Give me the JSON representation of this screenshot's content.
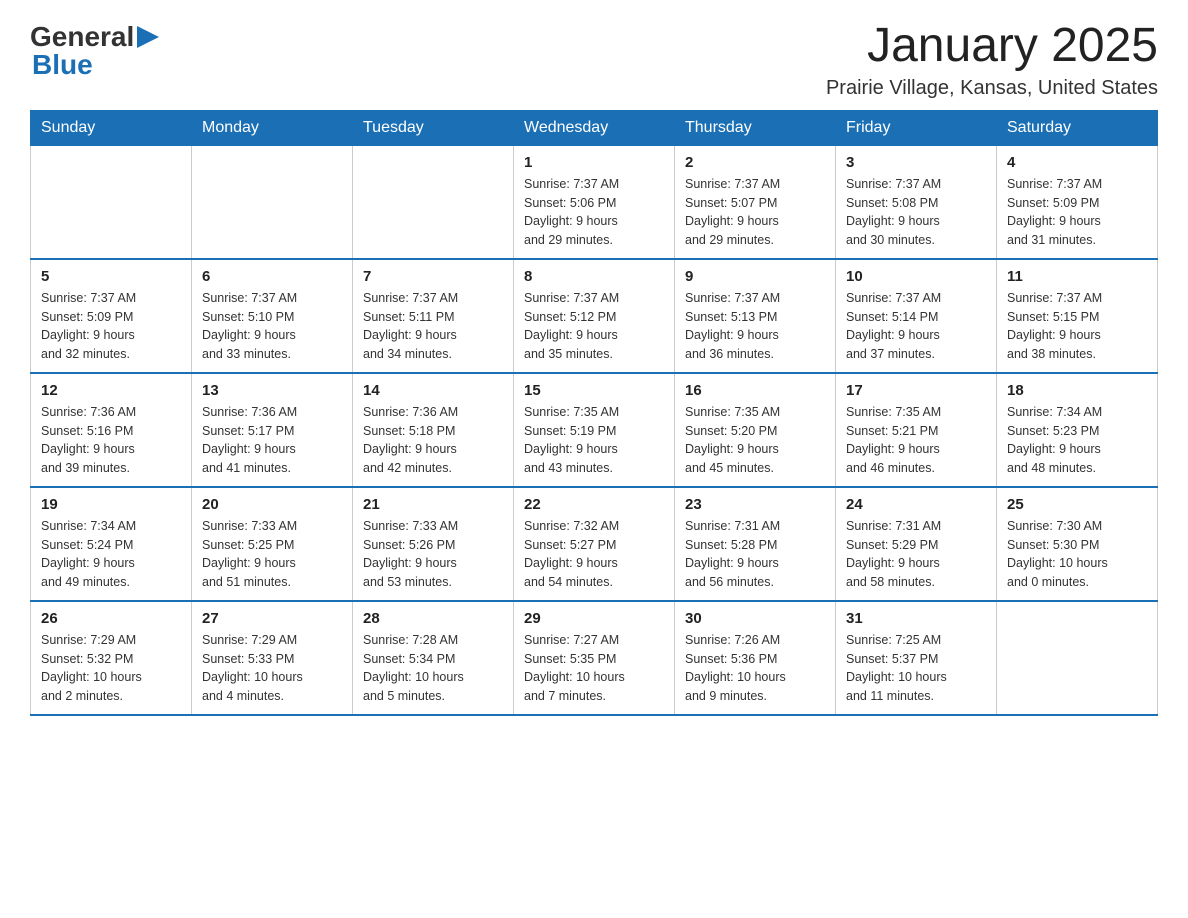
{
  "logo": {
    "general": "General",
    "blue_triangle": "▶",
    "blue": "Blue"
  },
  "title": "January 2025",
  "subtitle": "Prairie Village, Kansas, United States",
  "days_of_week": [
    "Sunday",
    "Monday",
    "Tuesday",
    "Wednesday",
    "Thursday",
    "Friday",
    "Saturday"
  ],
  "weeks": [
    [
      {
        "day": "",
        "info": ""
      },
      {
        "day": "",
        "info": ""
      },
      {
        "day": "",
        "info": ""
      },
      {
        "day": "1",
        "info": "Sunrise: 7:37 AM\nSunset: 5:06 PM\nDaylight: 9 hours\nand 29 minutes."
      },
      {
        "day": "2",
        "info": "Sunrise: 7:37 AM\nSunset: 5:07 PM\nDaylight: 9 hours\nand 29 minutes."
      },
      {
        "day": "3",
        "info": "Sunrise: 7:37 AM\nSunset: 5:08 PM\nDaylight: 9 hours\nand 30 minutes."
      },
      {
        "day": "4",
        "info": "Sunrise: 7:37 AM\nSunset: 5:09 PM\nDaylight: 9 hours\nand 31 minutes."
      }
    ],
    [
      {
        "day": "5",
        "info": "Sunrise: 7:37 AM\nSunset: 5:09 PM\nDaylight: 9 hours\nand 32 minutes."
      },
      {
        "day": "6",
        "info": "Sunrise: 7:37 AM\nSunset: 5:10 PM\nDaylight: 9 hours\nand 33 minutes."
      },
      {
        "day": "7",
        "info": "Sunrise: 7:37 AM\nSunset: 5:11 PM\nDaylight: 9 hours\nand 34 minutes."
      },
      {
        "day": "8",
        "info": "Sunrise: 7:37 AM\nSunset: 5:12 PM\nDaylight: 9 hours\nand 35 minutes."
      },
      {
        "day": "9",
        "info": "Sunrise: 7:37 AM\nSunset: 5:13 PM\nDaylight: 9 hours\nand 36 minutes."
      },
      {
        "day": "10",
        "info": "Sunrise: 7:37 AM\nSunset: 5:14 PM\nDaylight: 9 hours\nand 37 minutes."
      },
      {
        "day": "11",
        "info": "Sunrise: 7:37 AM\nSunset: 5:15 PM\nDaylight: 9 hours\nand 38 minutes."
      }
    ],
    [
      {
        "day": "12",
        "info": "Sunrise: 7:36 AM\nSunset: 5:16 PM\nDaylight: 9 hours\nand 39 minutes."
      },
      {
        "day": "13",
        "info": "Sunrise: 7:36 AM\nSunset: 5:17 PM\nDaylight: 9 hours\nand 41 minutes."
      },
      {
        "day": "14",
        "info": "Sunrise: 7:36 AM\nSunset: 5:18 PM\nDaylight: 9 hours\nand 42 minutes."
      },
      {
        "day": "15",
        "info": "Sunrise: 7:35 AM\nSunset: 5:19 PM\nDaylight: 9 hours\nand 43 minutes."
      },
      {
        "day": "16",
        "info": "Sunrise: 7:35 AM\nSunset: 5:20 PM\nDaylight: 9 hours\nand 45 minutes."
      },
      {
        "day": "17",
        "info": "Sunrise: 7:35 AM\nSunset: 5:21 PM\nDaylight: 9 hours\nand 46 minutes."
      },
      {
        "day": "18",
        "info": "Sunrise: 7:34 AM\nSunset: 5:23 PM\nDaylight: 9 hours\nand 48 minutes."
      }
    ],
    [
      {
        "day": "19",
        "info": "Sunrise: 7:34 AM\nSunset: 5:24 PM\nDaylight: 9 hours\nand 49 minutes."
      },
      {
        "day": "20",
        "info": "Sunrise: 7:33 AM\nSunset: 5:25 PM\nDaylight: 9 hours\nand 51 minutes."
      },
      {
        "day": "21",
        "info": "Sunrise: 7:33 AM\nSunset: 5:26 PM\nDaylight: 9 hours\nand 53 minutes."
      },
      {
        "day": "22",
        "info": "Sunrise: 7:32 AM\nSunset: 5:27 PM\nDaylight: 9 hours\nand 54 minutes."
      },
      {
        "day": "23",
        "info": "Sunrise: 7:31 AM\nSunset: 5:28 PM\nDaylight: 9 hours\nand 56 minutes."
      },
      {
        "day": "24",
        "info": "Sunrise: 7:31 AM\nSunset: 5:29 PM\nDaylight: 9 hours\nand 58 minutes."
      },
      {
        "day": "25",
        "info": "Sunrise: 7:30 AM\nSunset: 5:30 PM\nDaylight: 10 hours\nand 0 minutes."
      }
    ],
    [
      {
        "day": "26",
        "info": "Sunrise: 7:29 AM\nSunset: 5:32 PM\nDaylight: 10 hours\nand 2 minutes."
      },
      {
        "day": "27",
        "info": "Sunrise: 7:29 AM\nSunset: 5:33 PM\nDaylight: 10 hours\nand 4 minutes."
      },
      {
        "day": "28",
        "info": "Sunrise: 7:28 AM\nSunset: 5:34 PM\nDaylight: 10 hours\nand 5 minutes."
      },
      {
        "day": "29",
        "info": "Sunrise: 7:27 AM\nSunset: 5:35 PM\nDaylight: 10 hours\nand 7 minutes."
      },
      {
        "day": "30",
        "info": "Sunrise: 7:26 AM\nSunset: 5:36 PM\nDaylight: 10 hours\nand 9 minutes."
      },
      {
        "day": "31",
        "info": "Sunrise: 7:25 AM\nSunset: 5:37 PM\nDaylight: 10 hours\nand 11 minutes."
      },
      {
        "day": "",
        "info": ""
      }
    ]
  ]
}
